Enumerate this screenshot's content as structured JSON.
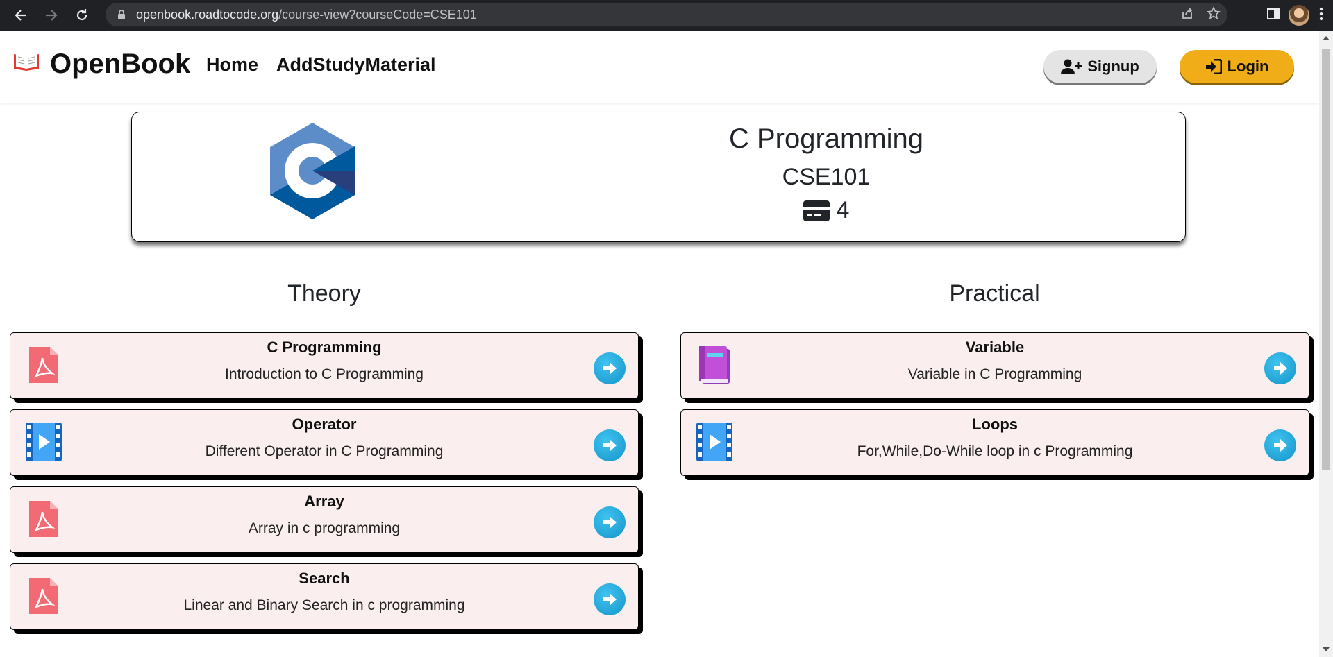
{
  "browser": {
    "url_host": "openbook.roadtocode.org",
    "url_path": "/course-view?courseCode=CSE101"
  },
  "navbar": {
    "brand": "OpenBook",
    "links": [
      "Home",
      "AddStudyMaterial"
    ],
    "signup_label": "Signup",
    "login_label": "Login",
    "signup_color": "#e4e4e4",
    "login_color": "#f0ad17"
  },
  "course": {
    "title": "C Programming",
    "code": "CSE101",
    "credits": "4",
    "logo_icon": "c-language-logo"
  },
  "theory": {
    "heading": "Theory",
    "items": [
      {
        "title": "C Programming",
        "desc": "Introduction to C Programming",
        "icon": "pdf-icon"
      },
      {
        "title": "Operator",
        "desc": "Different Operator in C Programming",
        "icon": "video-icon"
      },
      {
        "title": "Array",
        "desc": "Array in c programming",
        "icon": "pdf-icon"
      },
      {
        "title": "Search",
        "desc": "Linear and Binary Search in c programming",
        "icon": "pdf-icon"
      }
    ]
  },
  "practical": {
    "heading": "Practical",
    "items": [
      {
        "title": "Variable",
        "desc": "Variable in C Programming",
        "icon": "book-icon"
      },
      {
        "title": "Loops",
        "desc": "For,While,Do-While loop in c Programming",
        "icon": "video-icon"
      }
    ]
  }
}
